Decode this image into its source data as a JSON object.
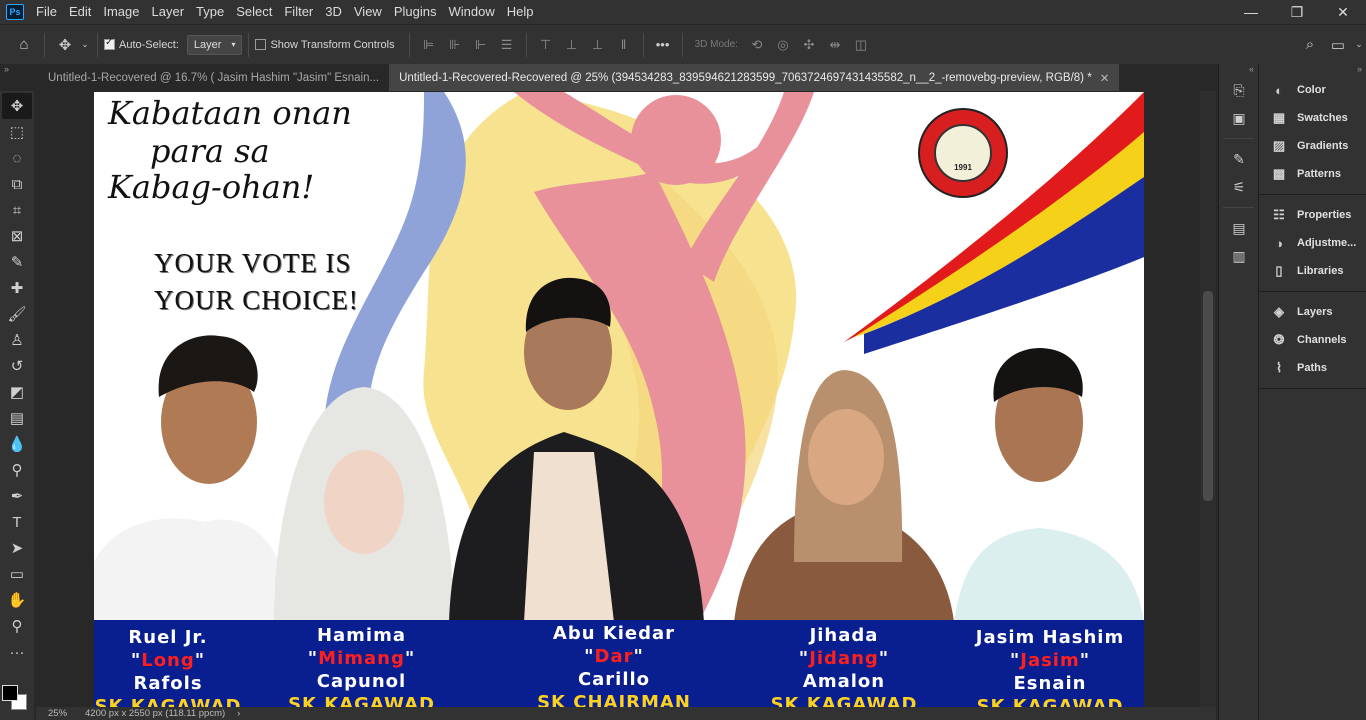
{
  "menubar": {
    "items": [
      "File",
      "Edit",
      "Image",
      "Layer",
      "Type",
      "Select",
      "Filter",
      "3D",
      "View",
      "Plugins",
      "Window",
      "Help"
    ],
    "logo": "Ps"
  },
  "options": {
    "auto_select_label": "Auto-Select:",
    "auto_select_value": "Layer",
    "transform_label": "Show Transform Controls",
    "mode_3d": "3D Mode:"
  },
  "tabs": [
    {
      "label": "Untitled-1-Recovered @ 16.7% (  Jasim Hashim      \"Jasim\"        Esnain...",
      "active": false
    },
    {
      "label": "Untitled-1-Recovered-Recovered @ 25% (394534283_839594621283599_7063724697431435582_n__2_-removebg-preview, RGB/8) *",
      "active": true
    }
  ],
  "status": {
    "zoom": "25%",
    "size": "4200 px x 2550 px (118.11 ppcm)"
  },
  "panels": {
    "group1": [
      "Color",
      "Swatches",
      "Gradients",
      "Patterns"
    ],
    "group2": [
      "Properties",
      "Adjustme...",
      "Libraries"
    ],
    "group3": [
      "Layers",
      "Channels",
      "Paths"
    ]
  },
  "poster": {
    "slogan": [
      "Kabataan onan",
      "para sa",
      "Kabag-ohan!"
    ],
    "vote": [
      "YOUR VOTE IS",
      "YOUR CHOICE!"
    ],
    "seal_year": "1991",
    "candidates": [
      {
        "name": "Ruel Jr.",
        "nick": "Long",
        "surname": "Rafols",
        "position": "SK KAGAWAD"
      },
      {
        "name": "Hamima",
        "nick": "Mimang",
        "surname": "Capunol",
        "position": "SK KAGAWAD"
      },
      {
        "name": "Abu Kiedar",
        "nick": "Dar",
        "surname": "Carillo",
        "position": "SK CHAIRMAN"
      },
      {
        "name": "Jihada",
        "nick": "Jidang",
        "surname": "Amalon",
        "position": "SK KAGAWAD"
      },
      {
        "name": "Jasim Hashim",
        "nick": "Jasim",
        "surname": "Esnain",
        "position": "SK KAGAWAD"
      }
    ]
  },
  "colors": {
    "banner": "#0a1f8f",
    "nick": "#ff1f1f",
    "position": "#ffd21a",
    "bg_pink": "#e8919b",
    "bg_yellow": "#f7e38f",
    "bg_blue": "#8fa3d8"
  }
}
